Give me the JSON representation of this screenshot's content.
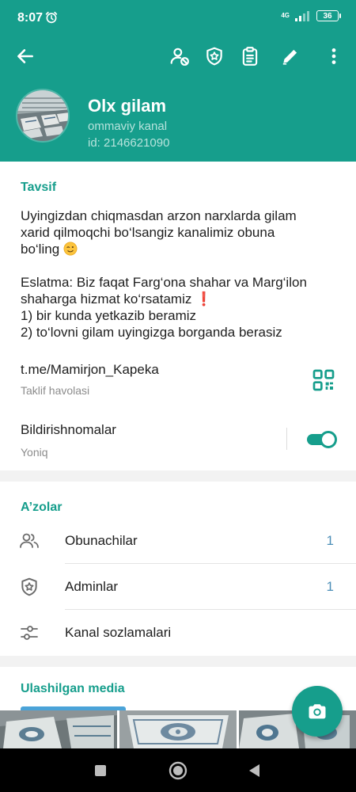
{
  "status_bar": {
    "time": "8:07",
    "network": "4G",
    "battery": "36",
    "alarm_icon": "alarm-icon",
    "signal_icon": "signal-icon"
  },
  "toolbar": {
    "back_icon": "arrow-back-icon",
    "block_user_icon": "user-block-icon",
    "admin_badge_icon": "shield-star-icon",
    "clipboard_icon": "clipboard-icon",
    "edit_icon": "pencil-icon",
    "more_icon": "more-vertical-icon"
  },
  "channel": {
    "name": "Olx gilam",
    "type": "ommaviy kanal",
    "id_text": "id: 2146621090"
  },
  "description": {
    "title": "Tavsif",
    "lines": [
      "Uyingizdan chiqmasdan arzon narxlarda gilam",
      "xarid qilmoqchi bo‘lsangiz kanalimiz obuna",
      "bo‘ling",
      "",
      "Eslatma: Biz faqat Farg‘ona shahar va Marg‘ilon",
      "shaharga hizmat ko‘rsatamiz",
      "1) bir kunda yetkazib beramiz",
      "2) to‘lovni gilam uyingizga borganda berasiz"
    ]
  },
  "invite_link": {
    "value": "t.me/Mamirjon_Kapeka",
    "label": "Taklif havolasi",
    "qr_icon": "qr-code-icon"
  },
  "notifications": {
    "title": "Bildirishnomalar",
    "state": "Yoniq",
    "enabled": true
  },
  "members": {
    "title": "A’zolar",
    "rows": [
      {
        "label": "Obunachilar",
        "count": "1",
        "icon": "users-icon"
      },
      {
        "label": "Adminlar",
        "count": "1",
        "icon": "shield-star-icon"
      },
      {
        "label": "Kanal sozlamalari",
        "count": "",
        "icon": "sliders-icon"
      }
    ]
  },
  "media": {
    "title": "Ulashilgan media",
    "thumbnails": 3
  },
  "fab": {
    "icon": "camera-icon"
  },
  "nav": {
    "recent_icon": "square-icon",
    "home_icon": "circle-icon",
    "back_icon": "triangle-back-icon"
  },
  "colors": {
    "primary": "#169e8c",
    "accent_blue": "#4aa3d8",
    "count_blue": "#4d8fb8"
  }
}
